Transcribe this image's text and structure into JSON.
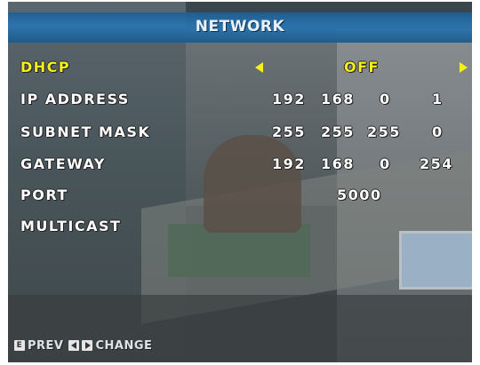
{
  "header": {
    "title": "NETWORK"
  },
  "menu": {
    "dhcp": {
      "label": "DHCP",
      "value": "OFF"
    },
    "ip_address": {
      "label": "IP ADDRESS",
      "octets": [
        "192",
        "168",
        "0",
        "1"
      ]
    },
    "subnet_mask": {
      "label": "SUBNET MASK",
      "octets": [
        "255",
        "255",
        "255",
        "0"
      ]
    },
    "gateway": {
      "label": "GATEWAY",
      "octets": [
        "192",
        "168",
        "0",
        "254"
      ]
    },
    "port": {
      "label": "PORT",
      "value": "5000"
    },
    "multicast": {
      "label": "MULTICAST",
      "value": ""
    }
  },
  "footer": {
    "key_e": "E",
    "prev_label": "PREV",
    "change_label": "CHANGE"
  },
  "colors": {
    "selected": "#f5ef1a",
    "title_bar": "#2a76b3",
    "text": "#ffffff"
  },
  "icons": [
    "left-arrow-icon",
    "right-arrow-icon",
    "e-key-icon",
    "left-key-icon",
    "right-key-icon"
  ]
}
